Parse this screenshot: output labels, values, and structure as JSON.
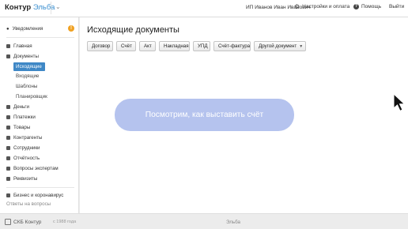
{
  "topbar": {
    "logo_main": "Контур",
    "logo_accent": "Эльба",
    "user": "ИП Иванов Иван Иванович",
    "settings_label": "Настройки и оплата",
    "help_label": "Помощь",
    "logout_label": "Выйти"
  },
  "sidebar": {
    "notifications": {
      "label": "Уведомления",
      "count": "!"
    },
    "items": [
      {
        "label": "Главная"
      },
      {
        "label": "Документы"
      }
    ],
    "documents_sub": [
      {
        "label": "Исходящие",
        "active": true
      },
      {
        "label": "Входящие"
      },
      {
        "label": "Шаблоны"
      },
      {
        "label": "Планировщик"
      }
    ],
    "items2": [
      {
        "label": "Деньги"
      },
      {
        "label": "Платежки"
      },
      {
        "label": "Товары"
      },
      {
        "label": "Контрагенты"
      },
      {
        "label": "Сотрудники"
      },
      {
        "label": "Отчётность"
      },
      {
        "label": "Вопросы экспертам"
      },
      {
        "label": "Реквизиты"
      }
    ],
    "extra": {
      "label": "Бизнес и коронавирус",
      "sub": "Ответы на вопросы"
    }
  },
  "main": {
    "title": "Исходящие документы",
    "buttons": [
      {
        "label": "Договор"
      },
      {
        "label": "Счёт"
      },
      {
        "label": "Акт"
      },
      {
        "label": "Накладная"
      },
      {
        "label": "УПД"
      },
      {
        "label": "Счёт-фактура"
      },
      {
        "label": "Другой документ"
      }
    ],
    "overlay_text": "Посмотрим, как выставить счёт"
  },
  "footer": {
    "brand": "СКБ Контур",
    "since": "с 1988 года",
    "app": "Эльба"
  },
  "colors": {
    "accent": "#3f88c6",
    "overlay": "#b5c3ee",
    "badge": "#f0a122"
  }
}
